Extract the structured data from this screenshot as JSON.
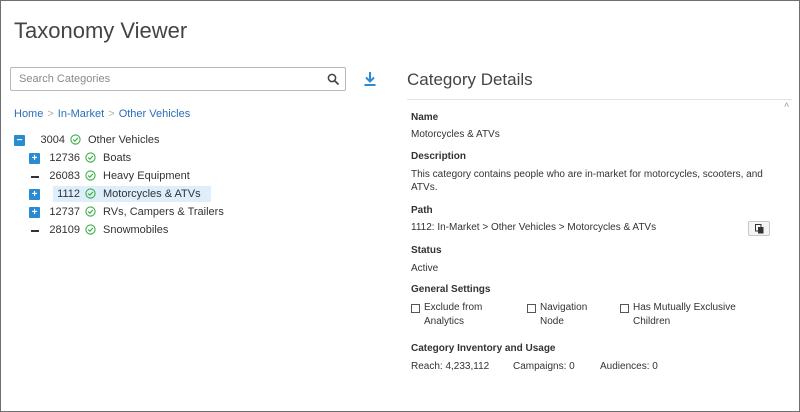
{
  "app_title": "Taxonomy Viewer",
  "search": {
    "placeholder": "Search Categories",
    "value": "",
    "icon": "search-icon"
  },
  "download_icon": "download-icon",
  "breadcrumb": {
    "items": [
      "Home",
      "In-Market",
      "Other Vehicles"
    ],
    "separator": ">"
  },
  "tree": {
    "rows": [
      {
        "code": "3004",
        "label": "Other Vehicles",
        "toggle": "−",
        "state": "expanded",
        "depth": 0,
        "selected": false
      },
      {
        "code": "12736",
        "label": "Boats",
        "toggle": "+",
        "state": "collapsed",
        "depth": 1,
        "selected": false
      },
      {
        "code": "26083",
        "label": "Heavy Equipment",
        "toggle": "",
        "state": "leaf",
        "depth": 1,
        "selected": false
      },
      {
        "code": "1112",
        "label": "Motorcycles & ATVs",
        "toggle": "+",
        "state": "collapsed",
        "depth": 1,
        "selected": true
      },
      {
        "code": "12737",
        "label": "RVs, Campers & Trailers",
        "toggle": "+",
        "state": "collapsed",
        "depth": 1,
        "selected": false
      },
      {
        "code": "28109",
        "label": "Snowmobiles",
        "toggle": "",
        "state": "leaf",
        "depth": 1,
        "selected": false
      }
    ]
  },
  "details": {
    "title": "Category Details",
    "name_label": "Name",
    "name_value": "Motorcycles & ATVs",
    "description_label": "Description",
    "description_line1": "This category contains people who are in-market for motorcycles, scooters, and",
    "description_line2": "ATVs.",
    "path_label": "Path",
    "path_value": "1112: In-Market > Other Vehicles > Motorcycles & ATVs",
    "status_label": "Status",
    "status_value": "Active",
    "general_label": "General Settings",
    "settings": [
      {
        "line1": "Exclude from",
        "line2": "Analytics",
        "checked": false
      },
      {
        "line1": "Navigation",
        "line2": "Node",
        "checked": false
      },
      {
        "line1": "Has Mutually Exclusive",
        "line2": "Children",
        "checked": false
      }
    ],
    "inventory_label": "Category Inventory and Usage",
    "reach": "Reach: 4,233,112",
    "campaigns": "Campaigns: 0",
    "audiences": "Audiences: 0"
  },
  "colors": {
    "accent": "#2a8bd2",
    "link": "#2a6ebb",
    "check_green": "#3fae49",
    "selected_row": "#dfeefb"
  }
}
